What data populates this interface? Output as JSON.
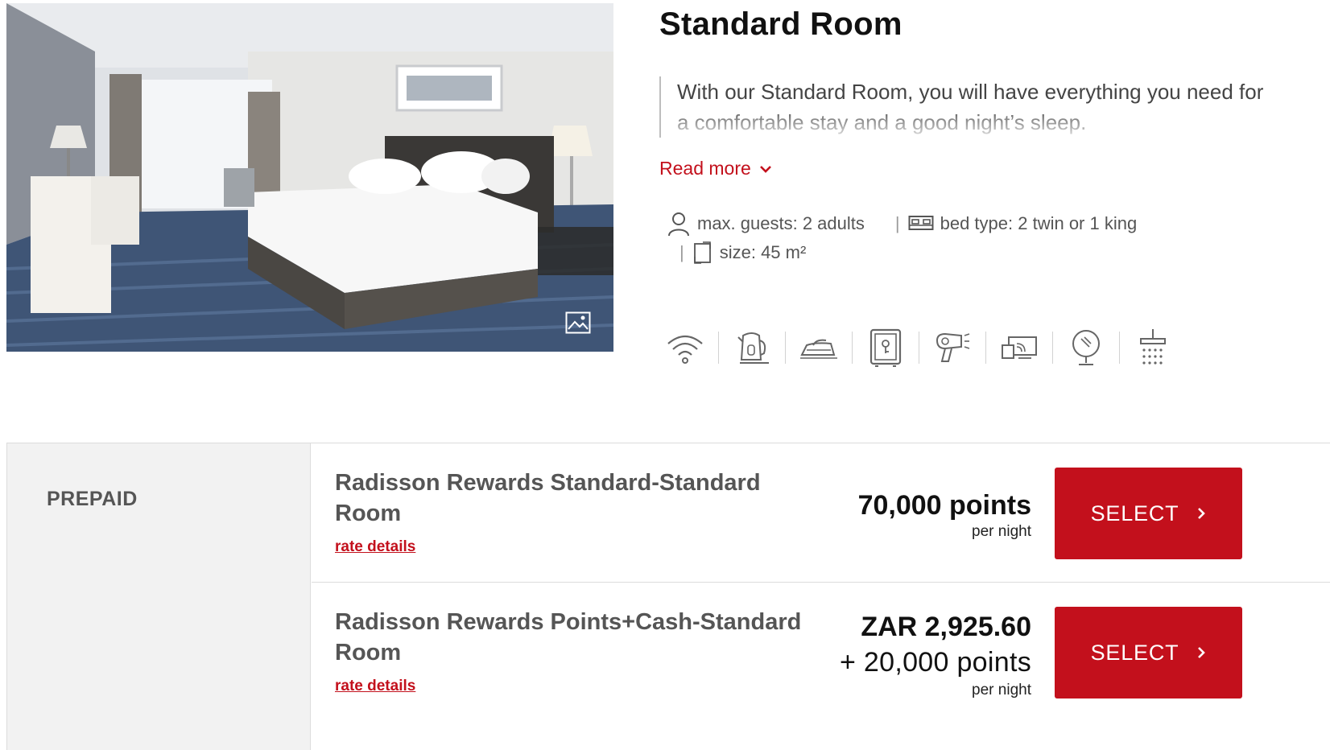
{
  "room": {
    "title": "Standard Room",
    "description": "With our Standard Room, you will have everything you need for a comfortable stay and a good night’s sleep.",
    "read_more": "Read more",
    "features": {
      "guests": "max. guests: 2 adults",
      "bed": "bed type: 2 twin or 1 king",
      "size": "size: 45 m²"
    },
    "separator": "|",
    "amenities": [
      "wifi-icon",
      "kettle-icon",
      "iron-icon",
      "safe-icon",
      "hairdryer-icon",
      "tv-cast-icon",
      "mirror-icon",
      "shower-icon"
    ]
  },
  "rates": {
    "category": "PREPAID",
    "items": [
      {
        "name": "Radisson Rewards Standard-Standard Room",
        "details_link": "rate details",
        "price_main": "70,000 points",
        "price_extra": "",
        "per": "per night",
        "button": "SELECT"
      },
      {
        "name": "Radisson Rewards Points+Cash-Standard Room",
        "details_link": "rate details",
        "price_main": "ZAR 2,925.60",
        "price_extra": "+ 20,000 points",
        "per": "per night",
        "button": "SELECT"
      }
    ]
  },
  "colors": {
    "accent": "#c3101c",
    "panel": "#f2f2f2"
  }
}
